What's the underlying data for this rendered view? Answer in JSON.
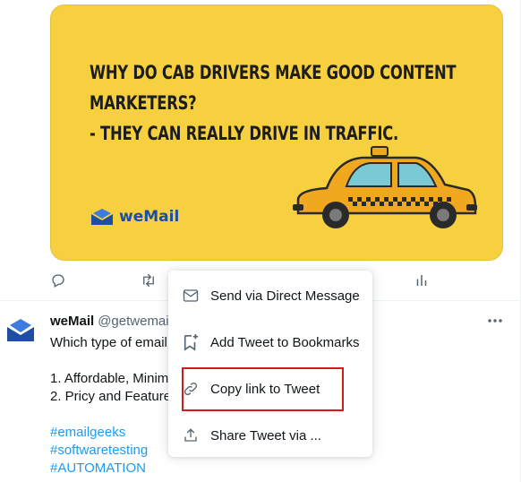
{
  "tweet1": {
    "media": {
      "lines": [
        "WHY DO CAB DRIVERS MAKE GOOD CONTENT",
        "MARKETERS?",
        "- THEY CAN REALLY DRIVE IN TRAFFIC."
      ],
      "logo_text": "weMail",
      "background": "#f6d03f"
    },
    "actions": [
      "reply-icon",
      "retweet-icon",
      "analytics-icon"
    ]
  },
  "tweet2": {
    "author_name": "weMail",
    "author_handle": "@getwemai",
    "body": [
      "Which type of email",
      "",
      "1. Affordable, Minim",
      "2. Pricy and Feature-"
    ],
    "hashtags": [
      "#emailgeeks",
      "#softwaretesting",
      "#AUTOMATION"
    ]
  },
  "menu": {
    "items": [
      {
        "label": "Send via Direct Message",
        "icon": "envelope-icon"
      },
      {
        "label": "Add Tweet to Bookmarks",
        "icon": "bookmark-add-icon"
      },
      {
        "label": "Copy link to Tweet",
        "icon": "link-icon"
      },
      {
        "label": "Share Tweet via ...",
        "icon": "share-icon"
      }
    ]
  },
  "colors": {
    "accent": "#1d9bf0",
    "highlight": "#d11a1a",
    "brand_blue": "#1d4ea1"
  }
}
